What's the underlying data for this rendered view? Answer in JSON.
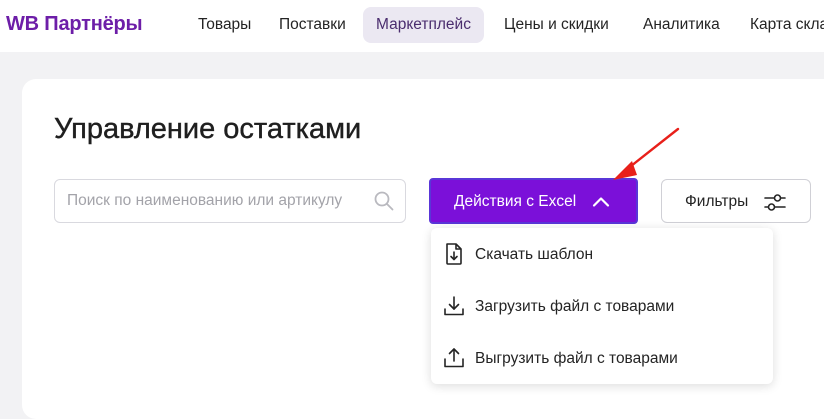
{
  "brand": "WB Партнёры",
  "nav": [
    {
      "label": "Товары"
    },
    {
      "label": "Поставки"
    },
    {
      "label": "Маркетплейс"
    },
    {
      "label": "Цены и скидки"
    },
    {
      "label": "Аналитика"
    },
    {
      "label": "Карта скла"
    }
  ],
  "nav_active_index": 2,
  "page": {
    "title": "Управление остатками"
  },
  "search": {
    "placeholder": "Поиск по наименованию или артикулу",
    "value": "",
    "icon": "search-icon"
  },
  "excel_button": {
    "label": "Действия с Excel",
    "icon": "chevron-up-icon",
    "expanded": true
  },
  "filters_button": {
    "label": "Фильтры",
    "icon": "sliders-icon"
  },
  "excel_menu": {
    "items": [
      {
        "label": "Скачать шаблон",
        "icon": "file-download-icon"
      },
      {
        "label": "Загрузить файл с товарами",
        "icon": "download-icon"
      },
      {
        "label": "Выгрузить файл с товарами",
        "icon": "upload-icon"
      }
    ]
  },
  "colors": {
    "brand": "#6d1ea8",
    "primary_button": "#7b10d9",
    "annotation_arrow": "#e8201a",
    "background": "#f2f2f4"
  }
}
